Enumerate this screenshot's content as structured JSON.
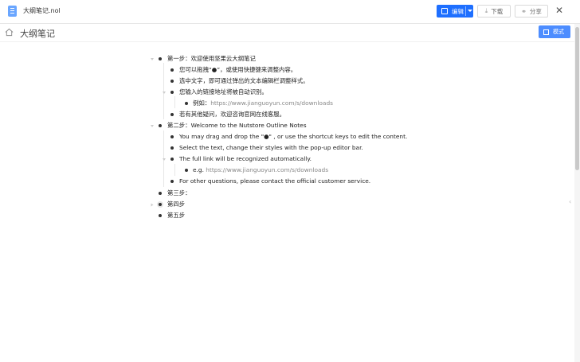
{
  "window": {
    "file_name": "大纲笔记.nol",
    "edit_label": "编辑",
    "download_label": "下载",
    "share_label": "分享",
    "close_symbol": "✕"
  },
  "doc": {
    "title": "大纲笔记",
    "mode_label": "模式"
  },
  "outline": [
    {
      "text": "第一步：欢迎使用坚果云大纲笔记"
    },
    {
      "text": "您可以拖拽“●”，或使用快捷键来调整内容。"
    },
    {
      "text": "选中文字，即可通过弹出的文本编辑栏调整样式。"
    },
    {
      "text": "您输入的链接地址将被自动识别。"
    },
    {
      "prefix": "例如：",
      "link": "https://www.jianguoyun.com/s/downloads"
    },
    {
      "text": "若有其他疑问，欢迎咨询官网在线客服。"
    },
    {
      "text": "第二步：Welcome to the Nutstore Outline Notes"
    },
    {
      "text": "You may drag and drop the \"●\" , or use the shortcut keys to edit the content."
    },
    {
      "text": "Select the text, change their styles with the pop-up editor bar."
    },
    {
      "text": "The full link will be recognized automatically."
    },
    {
      "prefix": "e.g. ",
      "link": "https://www.jianguoyun.com/s/downloads"
    },
    {
      "text": "For other questions, please contact the official customer service."
    },
    {
      "text": "第三步："
    },
    {
      "text": "第四步"
    },
    {
      "text": "第五步"
    }
  ]
}
